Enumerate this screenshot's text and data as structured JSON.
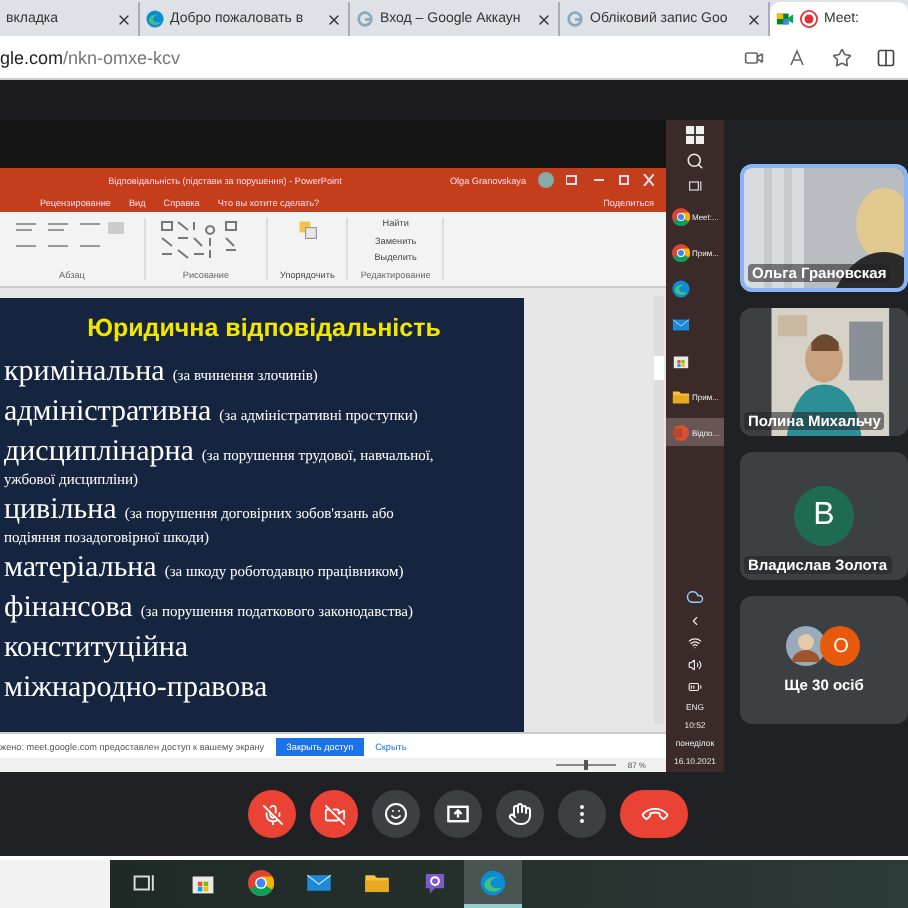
{
  "browser": {
    "tabs": [
      {
        "title": "вкладка",
        "kind": "plain",
        "selected": false
      },
      {
        "title": "Добро пожаловать в",
        "kind": "edge",
        "selected": false
      },
      {
        "title": "Вход – Google Аккаун",
        "kind": "google",
        "selected": false
      },
      {
        "title": "Обліковий запис Goo",
        "kind": "google",
        "selected": false
      },
      {
        "title": "Meet: ",
        "kind": "meet",
        "selected": true
      }
    ],
    "url_host": "gle.com",
    "url_path": "/nkn-omxe-kcv"
  },
  "powerpoint": {
    "title": "Відповідальність (підстави за порушення) - PowerPoint",
    "user": "Olga Granovskaya",
    "ribbon_tabs": [
      "Рецензирование",
      "Вид",
      "Справка"
    ],
    "tell_me": "Что вы хотите сделать?",
    "share": "Поделиться",
    "arrange": "Упорядочить",
    "edit_commands": [
      "Найти",
      "Заменить",
      "Выделить"
    ],
    "groups": [
      "Абзац",
      "Рисование",
      "Редактирование"
    ],
    "slide": {
      "title": "Юридична відповідальність",
      "items": [
        {
          "term": "кримінальна",
          "note": "(за вчинення злочинів)"
        },
        {
          "term": "адміністративна",
          "note": "(за адміністративні проступки)"
        },
        {
          "term": "дисциплінарна",
          "note": "(за порушення трудової, навчальної,",
          "continuation": "ужбової дисципліни)"
        },
        {
          "term": "цивільна",
          "note": "(за порушення договірних зобов'язань або",
          "continuation": "подіяння позадоговірної шкоди)"
        },
        {
          "term": "матеріальна",
          "note": "(за шкоду роботодавцю працівником)"
        },
        {
          "term": "фінансова",
          "note": "(за порушення податкового законодавства)"
        },
        {
          "term": "конституційна"
        },
        {
          "term": "міжнародно-правова"
        }
      ]
    },
    "share_notice": {
      "text": "жено: meet.google.com предоставлен доступ к вашему экрану",
      "stop_button": "Закрыть доступ",
      "hide_link": "Скрыть"
    },
    "zoom": "87 %",
    "zoom_slider": {
      "level": 0.5
    }
  },
  "side_taskbar": {
    "apps": [
      {
        "kind": "chrome",
        "label": "Meet:...",
        "selected": false
      },
      {
        "kind": "chrome",
        "label": "Прим...",
        "selected": false
      },
      {
        "kind": "edge",
        "selected": false
      },
      {
        "kind": "mail",
        "selected": false
      },
      {
        "kind": "store",
        "selected": false
      },
      {
        "kind": "folder",
        "label": "Прим...",
        "selected": false
      },
      {
        "kind": "powerpoint",
        "label": "Відпо...",
        "selected": true
      }
    ],
    "lang": "ENG",
    "time": "10:52",
    "day": "понеділок",
    "date": "16.10.2021"
  },
  "participants": [
    {
      "kind": "video",
      "name": "Ольга Грановская",
      "speaking": true
    },
    {
      "kind": "video",
      "name": "Полина Михальчу",
      "speaking": false
    },
    {
      "kind": "avatar",
      "name": "Владислав Золота",
      "initial": "В",
      "color": "#1e6b52",
      "speaking": false
    },
    {
      "kind": "more",
      "name": "Ще 30 осіб",
      "initial": "О",
      "color": "#e8590c",
      "speaking": false
    }
  ],
  "controls": [
    {
      "kind": "mic",
      "off": true
    },
    {
      "kind": "camera",
      "off": true
    },
    {
      "kind": "emoji",
      "off": false
    },
    {
      "kind": "present",
      "off": false
    },
    {
      "kind": "hand",
      "off": false
    },
    {
      "kind": "more",
      "off": false
    },
    {
      "kind": "end"
    }
  ],
  "taskbar": {
    "apps": [
      {
        "kind": "taskview",
        "selected": false
      },
      {
        "kind": "store",
        "selected": false
      },
      {
        "kind": "chrome",
        "selected": false
      },
      {
        "kind": "mail",
        "selected": false
      },
      {
        "kind": "folder",
        "selected": false
      },
      {
        "kind": "viber",
        "selected": false
      },
      {
        "kind": "edge",
        "selected": true
      }
    ]
  }
}
